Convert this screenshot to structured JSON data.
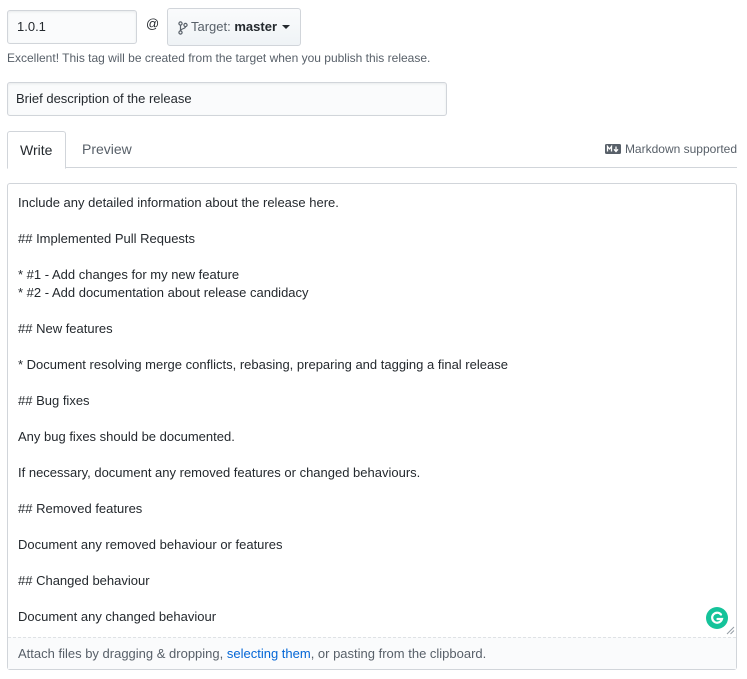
{
  "release": {
    "tag_value": "1.0.1",
    "at_sign": "@",
    "target_prefix": "Target:",
    "target_branch": "master",
    "tag_note": "Excellent! This tag will be created from the target when you publish this release.",
    "title_value": "Brief description of the release"
  },
  "tabs": {
    "write": "Write",
    "preview": "Preview",
    "markdown_supported": "Markdown supported"
  },
  "editor": {
    "body": "Include any detailed information about the release here.\n\n## Implemented Pull Requests\n\n* #1 - Add changes for my new feature\n* #2 - Add documentation about release candidacy\n\n## New features\n\n* Document resolving merge conflicts, rebasing, preparing and tagging a final release\n\n## Bug fixes\n\nAny bug fixes should be documented.\n\nIf necessary, document any removed features or changed behaviours.\n\n## Removed features\n\nDocument any removed behaviour or features\n\n## Changed behaviour\n\nDocument any changed behaviour"
  },
  "attach": {
    "prefix": "Attach files by dragging & dropping, ",
    "link": "selecting them",
    "suffix": ", or pasting from the clipboard."
  },
  "colors": {
    "link": "#0366d6",
    "grammarly": "#15c39a",
    "border": "#d1d5da"
  },
  "icons": {
    "branch": "git-branch-icon",
    "markdown": "markdown-icon",
    "grammarly": "grammarly-icon",
    "caret": "caret-down-icon"
  }
}
